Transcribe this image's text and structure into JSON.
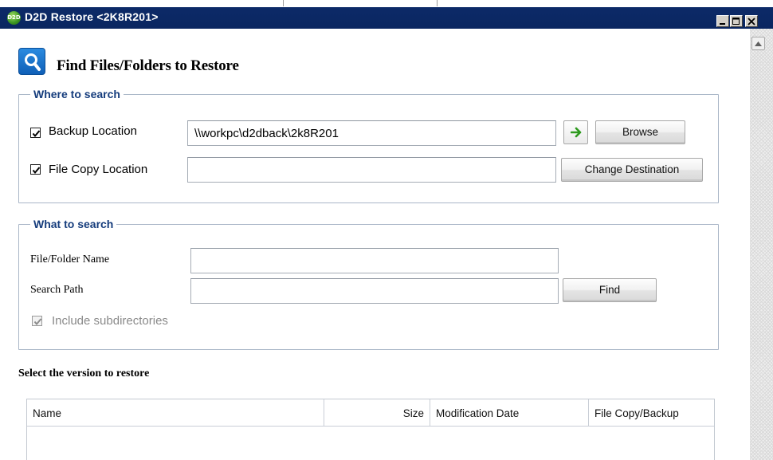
{
  "window": {
    "title": "D2D Restore <2K8R201>",
    "icon_text": "D2D",
    "minimize_icon": "minimize-icon",
    "maximize_icon": "maximize-icon",
    "close_icon": "close-icon"
  },
  "header": {
    "title": "Find Files/Folders to Restore",
    "icon": "search-icon"
  },
  "where_to_search": {
    "legend": "Where to search",
    "backup_location": {
      "label": "Backup Location",
      "checked": true,
      "value": "\\\\workpc\\d2dback\\2k8R201",
      "go_icon": "arrow-right-icon",
      "browse_label": "Browse"
    },
    "file_copy_location": {
      "label": "File Copy Location",
      "checked": true,
      "value": "",
      "change_label": "Change Destination"
    }
  },
  "what_to_search": {
    "legend": "What to search",
    "file_folder_name": {
      "label": "File/Folder Name",
      "value": ""
    },
    "search_path": {
      "label": "Search Path",
      "value": "",
      "find_label": "Find"
    },
    "include_subdirectories": {
      "label": "Include subdirectories",
      "checked": true,
      "enabled": false
    }
  },
  "versions": {
    "title": "Select the version to restore",
    "columns": [
      "Name",
      "Size",
      "Modification Date",
      "File Copy/Backup"
    ],
    "rows": []
  },
  "colors": {
    "titlebar": "#0a2660",
    "legend_text": "#153c7c",
    "group_border": "#a9b6c7",
    "go_arrow": "#2e9a1e"
  }
}
